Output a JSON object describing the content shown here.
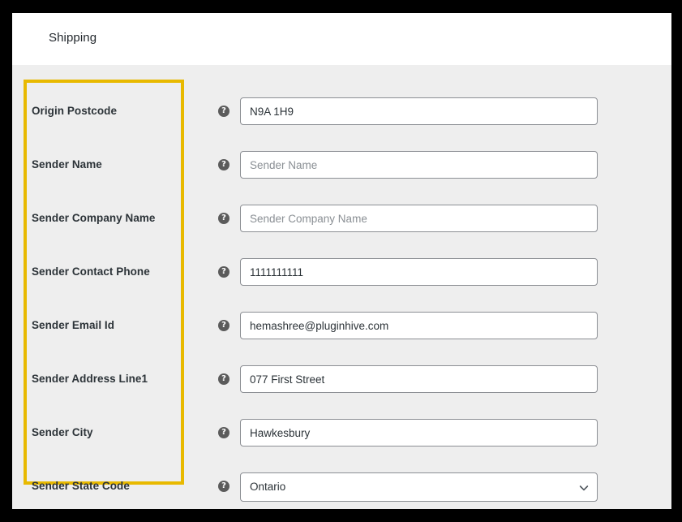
{
  "header": {
    "title": "Shipping"
  },
  "theme": {
    "highlight_color": "#e8b900",
    "panel_bg": "#eeeeee",
    "header_bg": "#ffffff",
    "label_color": "#2c3338",
    "input_border": "#8c8f94",
    "placeholder_color": "#8a8f94"
  },
  "form": {
    "help_icon_glyph": "?",
    "help_icon_name": "question-mark-help-icon",
    "rows": [
      {
        "label": "Origin Postcode",
        "type": "text",
        "value": "N9A 1H9",
        "placeholder": "",
        "filled": true,
        "name": "origin-postcode"
      },
      {
        "label": "Sender Name",
        "type": "text",
        "value": "",
        "placeholder": "Sender Name",
        "filled": false,
        "name": "sender-name"
      },
      {
        "label": "Sender Company Name",
        "type": "text",
        "value": "",
        "placeholder": "Sender Company Name",
        "filled": false,
        "name": "sender-company-name"
      },
      {
        "label": "Sender Contact Phone",
        "type": "text",
        "value": "1111111111",
        "placeholder": "",
        "filled": true,
        "name": "sender-contact-phone"
      },
      {
        "label": "Sender Email Id",
        "type": "text",
        "value": "hemashree@pluginhive.com",
        "placeholder": "",
        "filled": true,
        "name": "sender-email-id"
      },
      {
        "label": "Sender Address Line1",
        "type": "text",
        "value": "077 First Street",
        "placeholder": "",
        "filled": true,
        "name": "sender-address-line1"
      },
      {
        "label": "Sender City",
        "type": "text",
        "value": "Hawkesbury",
        "placeholder": "",
        "filled": true,
        "name": "sender-city"
      },
      {
        "label": "Sender State Code",
        "type": "select",
        "value": "Ontario",
        "placeholder": "",
        "filled": true,
        "name": "sender-state-code"
      }
    ]
  }
}
